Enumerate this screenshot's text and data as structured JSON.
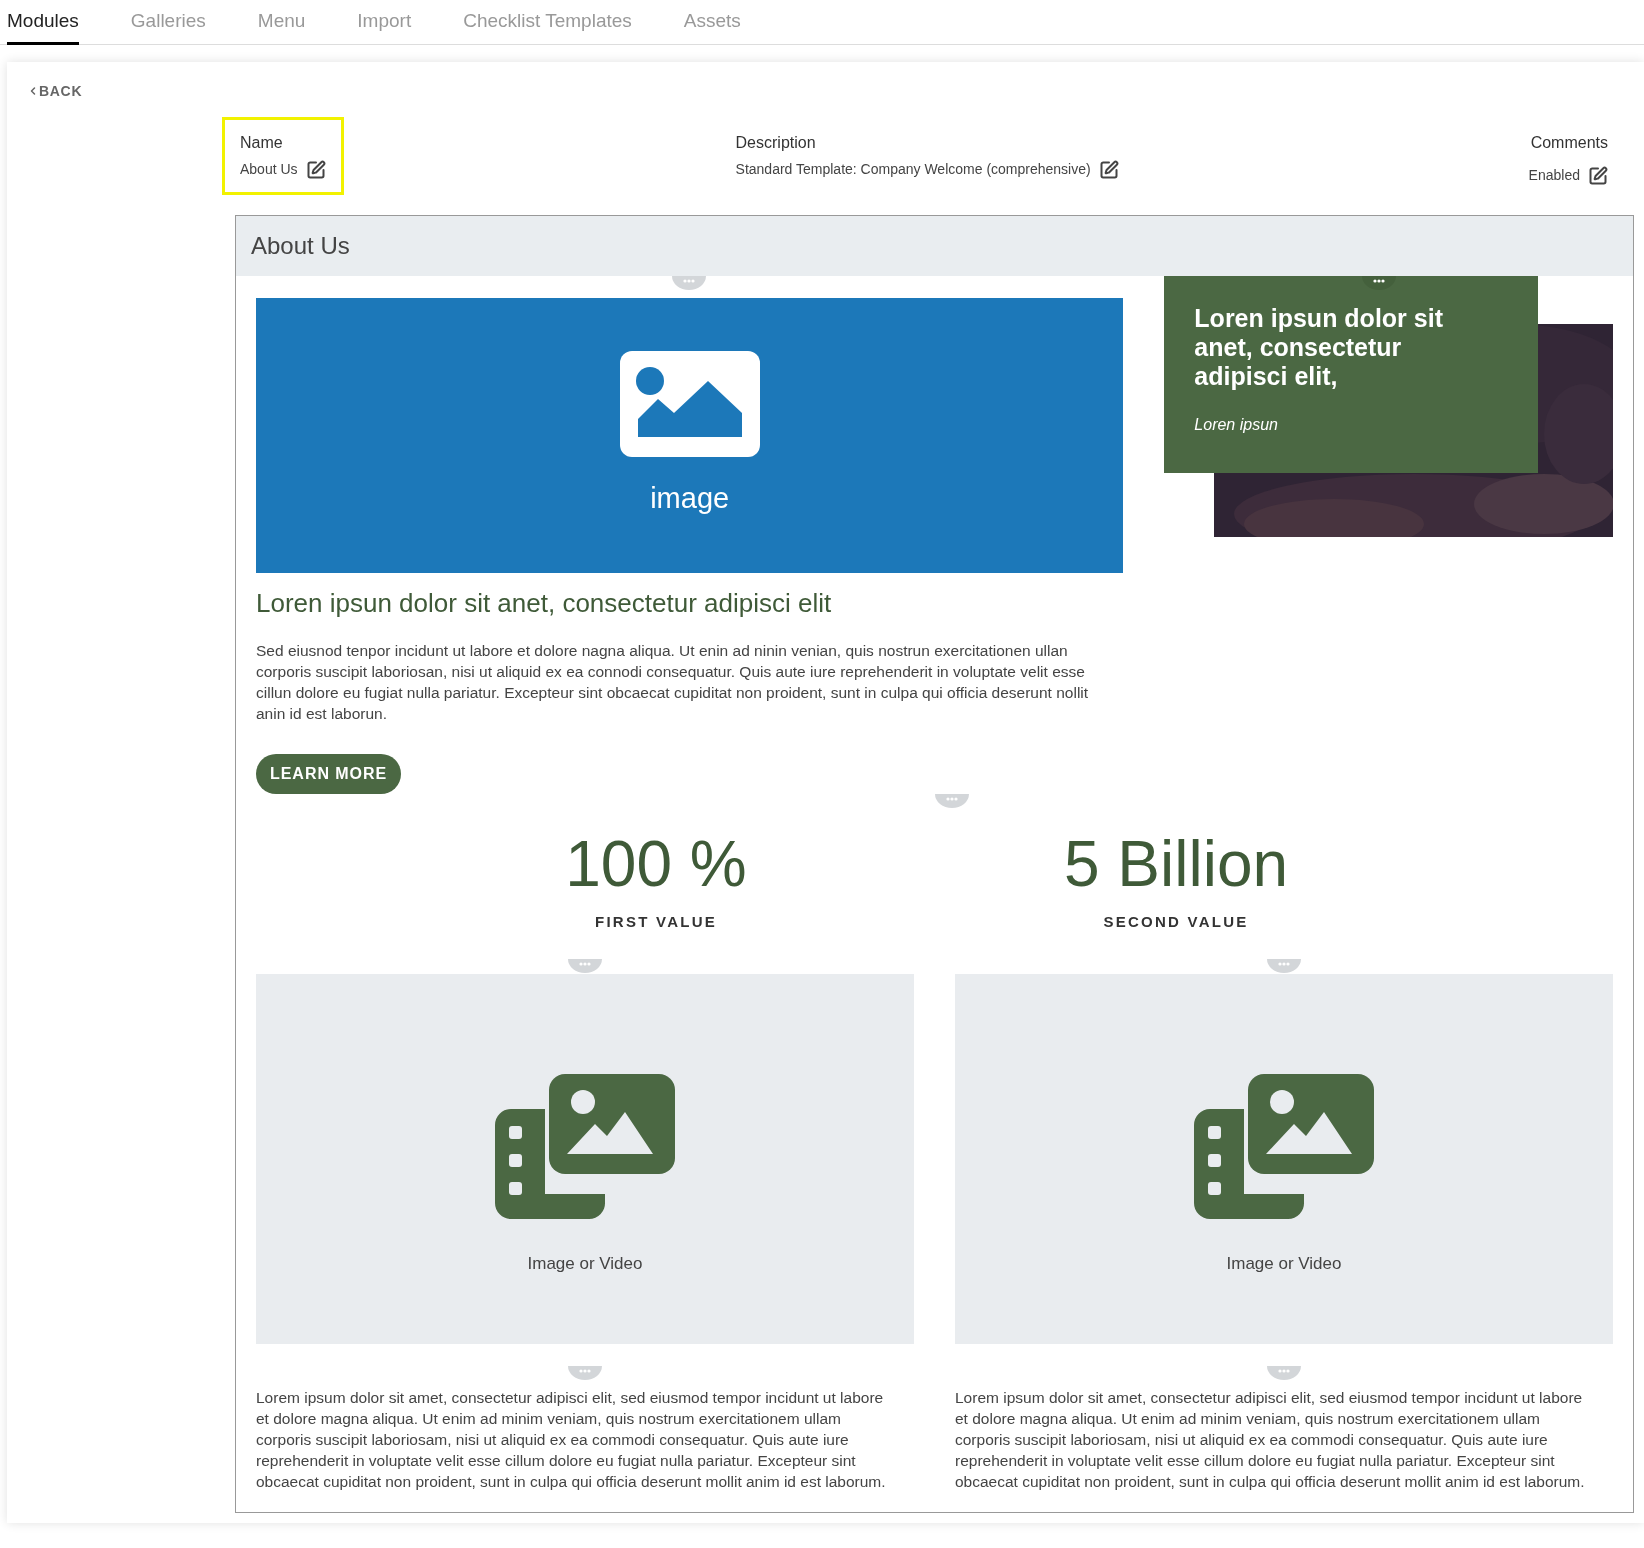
{
  "tabs": [
    {
      "label": "Modules",
      "selected": true
    },
    {
      "label": "Galleries",
      "selected": false
    },
    {
      "label": "Menu",
      "selected": false
    },
    {
      "label": "Import",
      "selected": false
    },
    {
      "label": "Checklist Templates",
      "selected": false
    },
    {
      "label": "Assets",
      "selected": false
    }
  ],
  "back": {
    "label": "BACK"
  },
  "fields": [
    {
      "label": "Name",
      "value": "About Us",
      "highlighted": true
    },
    {
      "label": "Description",
      "value": "Standard Template: Company Welcome (comprehensive)",
      "highlighted": false
    },
    {
      "label": "Comments",
      "value": "Enabled",
      "highlighted": false
    }
  ],
  "module": {
    "title": "About Us",
    "hero": {
      "image_label": "image",
      "heading": "Loren ipsun dolor sit anet, consectetur adipisci elit",
      "body": "Sed eiusnod tenpor incidunt ut labore et dolore nagna aliqua. Ut enin ad ninin venian, quis nostrun exercitationen ullan corporis suscipit laboriosan, nisi ut aliquid ex ea connodi consequatur. Quis aute iure reprehenderit in voluptate velit esse cillun dolore eu fugiat nulla pariatur. Excepteur sint obcaecat cupiditat non proident, sunt in culpa qui officia deserunt nollit anin id est laborun.",
      "button": "LEARN MORE"
    },
    "quote_card": {
      "text": "Loren ipsun dolor sit anet, consectetur adipisci elit,",
      "caption": "Loren ipsun"
    },
    "stats": [
      {
        "value": "100 %",
        "label": "FIRST VALUE"
      },
      {
        "value": "5 Billion",
        "label": "SECOND VALUE"
      }
    ],
    "media": [
      {
        "label": "Image or Video",
        "body": "Lorem ipsum dolor sit amet, consectetur adipisci elit, sed eiusmod tempor incidunt ut labore et dolore magna aliqua. Ut enim ad minim veniam, quis nostrum exercitationem ullam corporis suscipit laboriosam, nisi ut aliquid ex ea commodi consequatur. Quis aute iure reprehenderit in voluptate velit esse cillum dolore eu fugiat nulla pariatur. Excepteur sint obcaecat cupiditat non proident, sunt in culpa qui officia deserunt mollit anim id est laborum."
      },
      {
        "label": "Image or Video",
        "body": "Lorem ipsum dolor sit amet, consectetur adipisci elit, sed eiusmod tempor incidunt ut labore et dolore magna aliqua. Ut enim ad minim veniam, quis nostrum exercitationem ullam corporis suscipit laboriosam, nisi ut aliquid ex ea commodi consequatur. Quis aute iure reprehenderit in voluptate velit esse cillum dolore eu fugiat nulla pariatur. Excepteur sint obcaecat cupiditat non proident, sunt in culpa qui officia deserunt mollit anim id est laborum."
      }
    ]
  }
}
